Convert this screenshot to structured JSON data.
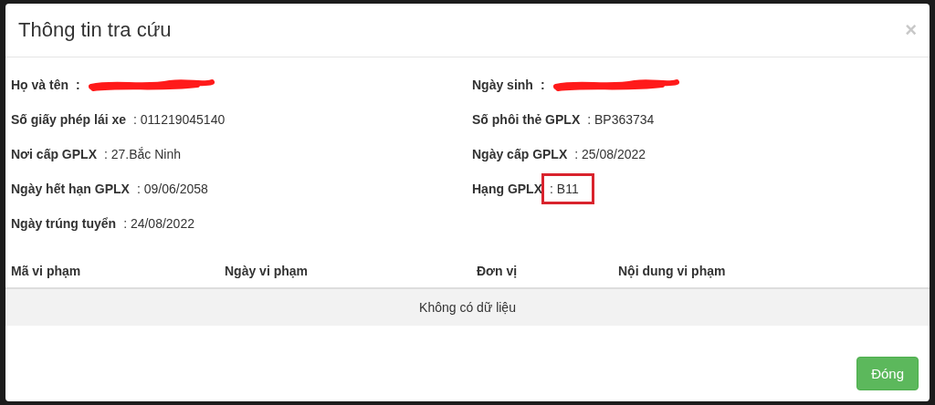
{
  "dialog": {
    "title": "Thông tin tra cứu",
    "close": "×"
  },
  "fields": [
    {
      "label": "Họ và tên",
      "kind": "redacted",
      "value": ":"
    },
    {
      "label": "Ngày sinh",
      "kind": "redacted",
      "value": ":"
    },
    {
      "label": "Số giấy phép lái xe",
      "kind": "text",
      "value": ": 011219045140"
    },
    {
      "label": "Số phôi thẻ GPLX",
      "kind": "text",
      "value": ": BP363734"
    },
    {
      "label": "Nơi cấp GPLX",
      "kind": "text",
      "value": ": 27.Bắc Ninh"
    },
    {
      "label": "Ngày cấp GPLX",
      "kind": "text",
      "value": ": 25/08/2022"
    },
    {
      "label": "Ngày hết hạn GPLX",
      "kind": "text",
      "value": ": 09/06/2058"
    },
    {
      "label": "Hạng GPLX",
      "kind": "text",
      "value": ": B11",
      "highlighted": true
    },
    {
      "label": "Ngày trúng tuyển",
      "kind": "text",
      "value": ": 24/08/2022"
    }
  ],
  "table": {
    "columns": [
      "Mã vi phạm",
      "Ngày vi phạm",
      "Đơn vị",
      "Nội dung vi phạm"
    ],
    "empty": "Không có dữ liệu"
  },
  "buttons": [
    "Đóng"
  ]
}
